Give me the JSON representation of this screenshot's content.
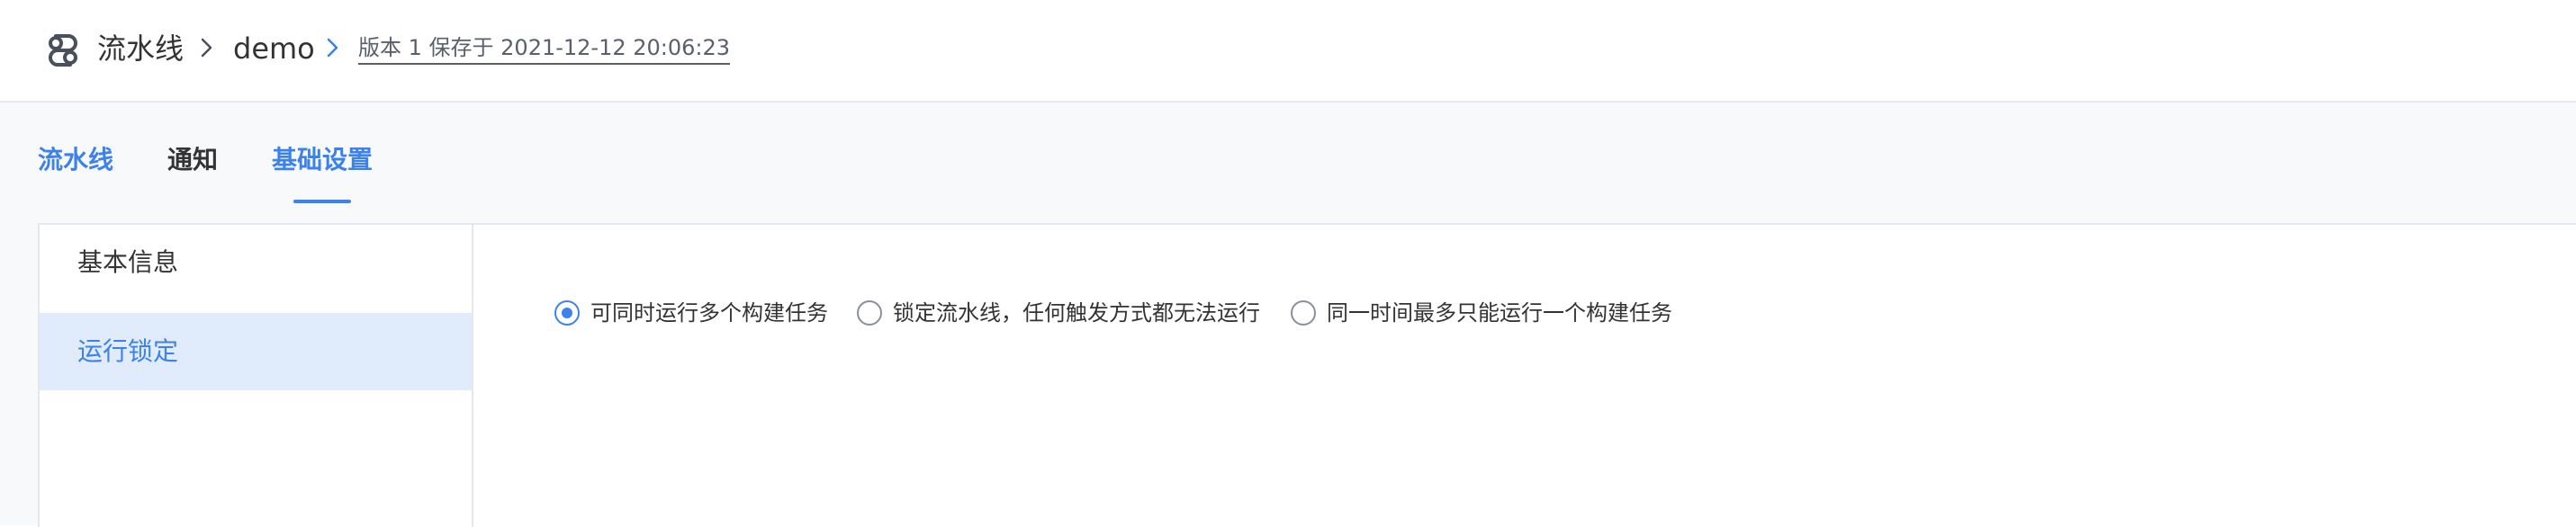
{
  "header": {
    "breadcrumb_root": "流水线",
    "breadcrumb_pipeline": "demo",
    "version_info": "版本 1 保存于 2021-12-12 20:06:23",
    "icons": {
      "logo": "pipeline-logo-icon",
      "separator": "chevron-right-icon"
    },
    "colors": {
      "accent": "#3c82ea",
      "text": "#333333"
    }
  },
  "tabs": [
    {
      "label": "流水线",
      "active": false
    },
    {
      "label": "通知",
      "active": false
    },
    {
      "label": "基础设置",
      "active": true
    }
  ],
  "side_menu": {
    "items": [
      {
        "label": "基本信息",
        "selected": false
      },
      {
        "label": "运行锁定",
        "selected": true
      }
    ]
  },
  "run_lock": {
    "options": [
      {
        "label": "可同时运行多个构建任务",
        "checked": true
      },
      {
        "label": "锁定流水线，任何触发方式都无法运行",
        "checked": false
      },
      {
        "label": "同一时间最多只能运行一个构建任务",
        "checked": false
      }
    ]
  }
}
